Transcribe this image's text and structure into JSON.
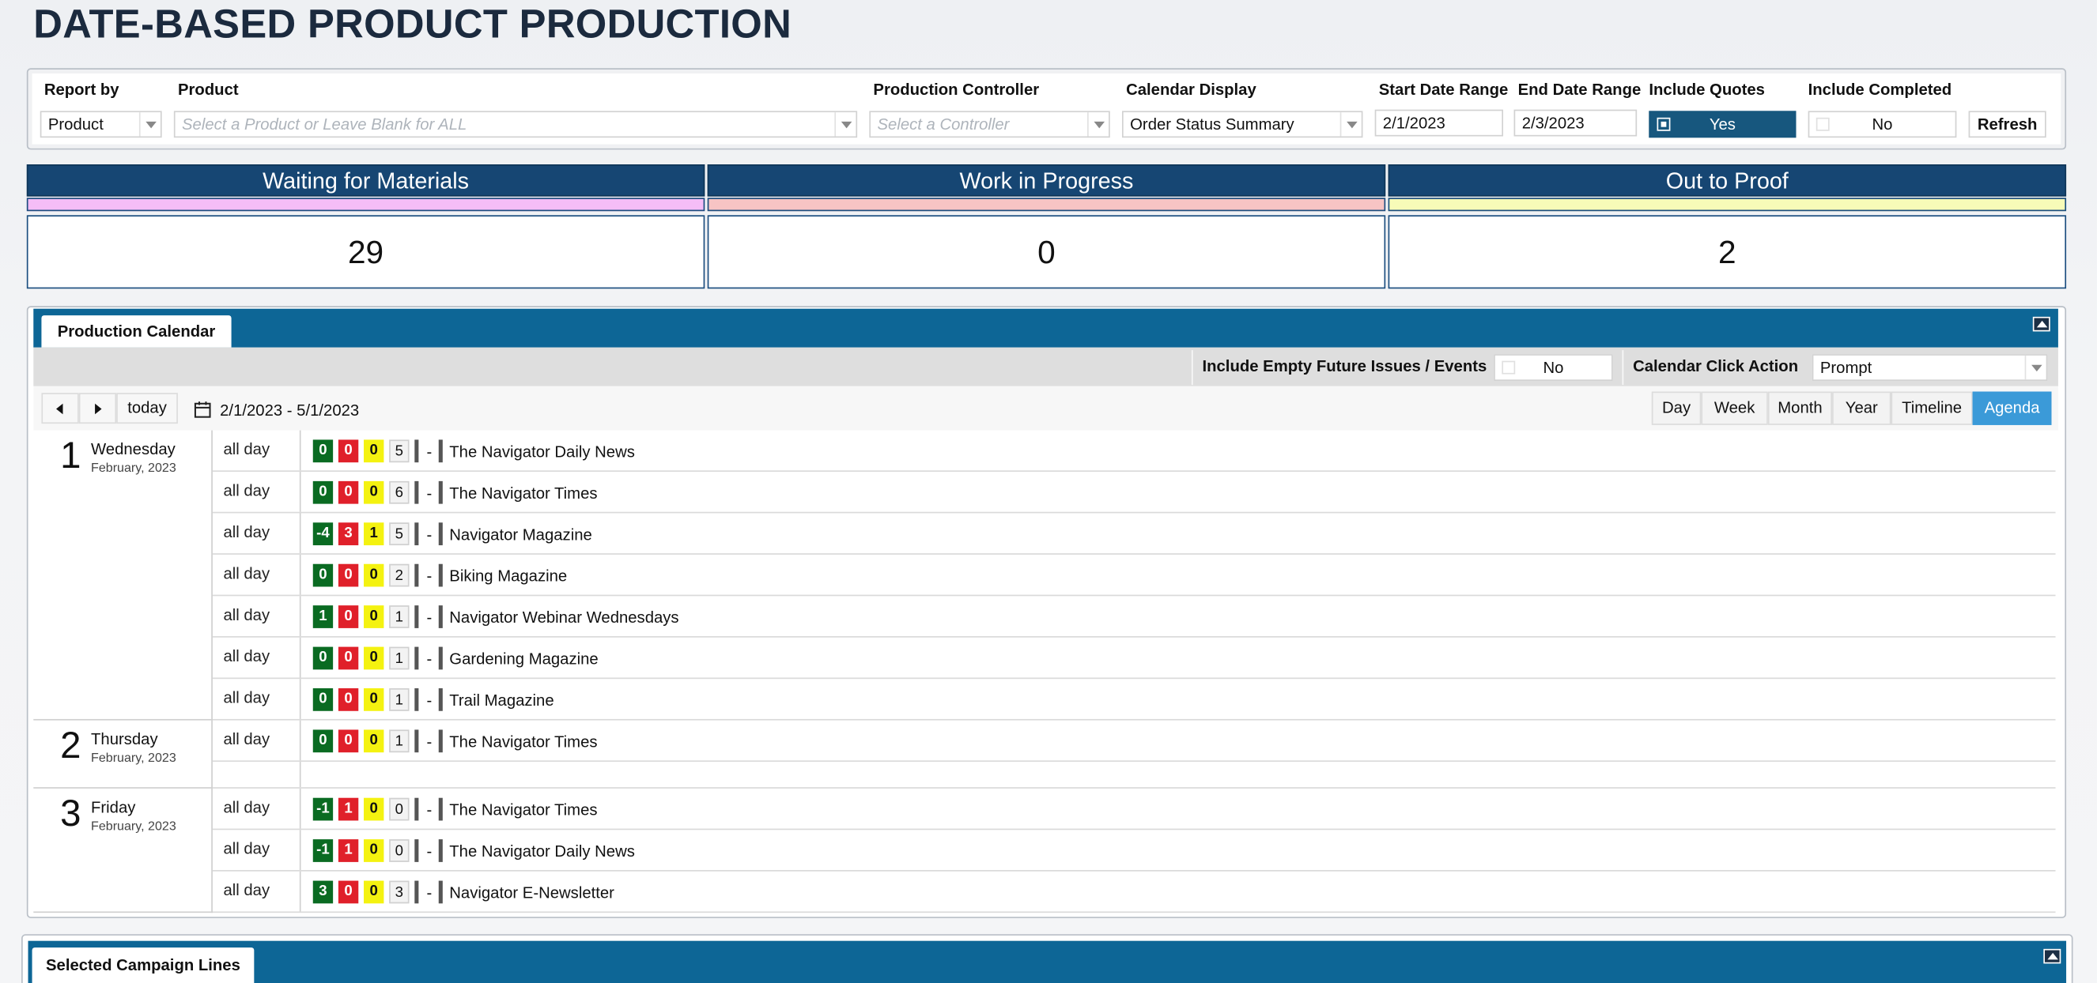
{
  "page": {
    "title": "DATE-BASED PRODUCT PRODUCTION"
  },
  "filters": {
    "report_by": {
      "label": "Report by",
      "value": "Product"
    },
    "product": {
      "label": "Product",
      "placeholder": "Select a Product or Leave Blank for ALL"
    },
    "controller": {
      "label": "Production Controller",
      "placeholder": "Select a Controller"
    },
    "calendar_display": {
      "label": "Calendar Display",
      "value": "Order Status Summary"
    },
    "start_date": {
      "label": "Start Date Range",
      "value": "2/1/2023"
    },
    "end_date": {
      "label": "End Date Range",
      "value": "2/3/2023"
    },
    "include_quotes": {
      "label": "Include Quotes",
      "value": "Yes"
    },
    "include_completed": {
      "label": "Include Completed",
      "value": "No"
    },
    "refresh_label": "Refresh"
  },
  "status_summary": [
    {
      "label": "Waiting for Materials",
      "count": "29",
      "color": "#f5bdf7"
    },
    {
      "label": "Work in Progress",
      "count": "0",
      "color": "#f7c4c4"
    },
    {
      "label": "Out to Proof",
      "count": "2",
      "color": "#f7fbb8"
    }
  ],
  "calendar": {
    "tab_label": "Production Calendar",
    "include_empty_label": "Include Empty Future Issues / Events",
    "include_empty_value": "No",
    "click_action_label": "Calendar Click Action",
    "click_action_value": "Prompt",
    "today_label": "today",
    "range": "2/1/2023 - 5/1/2023",
    "views": [
      "Day",
      "Week",
      "Month",
      "Year",
      "Timeline",
      "Agenda"
    ],
    "active_view": "Agenda",
    "allday_label": "all day",
    "dash": "-",
    "days": [
      {
        "num": "1",
        "name": "Wednesday",
        "month": "February, 2023",
        "events": [
          {
            "badges": [
              "0",
              "0",
              "0",
              "5"
            ],
            "name": "The Navigator Daily News"
          },
          {
            "badges": [
              "0",
              "0",
              "0",
              "6"
            ],
            "name": "The Navigator Times"
          },
          {
            "badges": [
              "-4",
              "3",
              "1",
              "5"
            ],
            "name": "Navigator Magazine"
          },
          {
            "badges": [
              "0",
              "0",
              "0",
              "2"
            ],
            "name": "Biking Magazine"
          },
          {
            "badges": [
              "1",
              "0",
              "0",
              "1"
            ],
            "name": "Navigator Webinar Wednesdays"
          },
          {
            "badges": [
              "0",
              "0",
              "0",
              "1"
            ],
            "name": "Gardening Magazine"
          },
          {
            "badges": [
              "0",
              "0",
              "0",
              "1"
            ],
            "name": "Trail Magazine"
          }
        ]
      },
      {
        "num": "2",
        "name": "Thursday",
        "month": "February, 2023",
        "events": [
          {
            "badges": [
              "0",
              "0",
              "0",
              "1"
            ],
            "name": "The Navigator Times"
          }
        ]
      },
      {
        "num": "3",
        "name": "Friday",
        "month": "February, 2023",
        "events": [
          {
            "badges": [
              "-1",
              "1",
              "0",
              "0"
            ],
            "name": "The Navigator Times"
          },
          {
            "badges": [
              "-1",
              "1",
              "0",
              "0"
            ],
            "name": "The Navigator Daily News"
          },
          {
            "badges": [
              "3",
              "0",
              "0",
              "3"
            ],
            "name": "Navigator E-Newsletter"
          }
        ]
      }
    ]
  },
  "campaign": {
    "tab_label": "Selected Campaign Lines"
  },
  "colors": {
    "header_navy": "#164673",
    "panel_blue": "#0d6696",
    "agenda_active": "#3b9ad8",
    "badge_green": "#0a6b22",
    "badge_red": "#e0202a",
    "badge_yellow": "#f4f210"
  }
}
